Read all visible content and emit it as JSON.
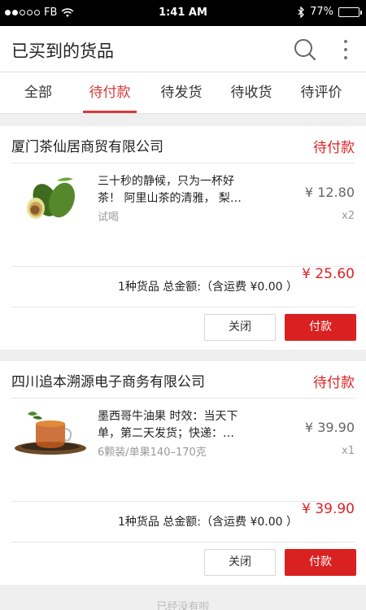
{
  "status_bar": {
    "carrier": "FB",
    "time": "1:41 AM",
    "battery": "77%",
    "battery_level": 0.77,
    "signal_bars": 2
  },
  "header": {
    "title": "已买到的货品"
  },
  "tabs": [
    {
      "label": "全部",
      "active": false
    },
    {
      "label": "待付款",
      "active": true
    },
    {
      "label": "待发货",
      "active": false
    },
    {
      "label": "待收货",
      "active": false
    },
    {
      "label": "待评价",
      "active": false
    }
  ],
  "orders": [
    {
      "store": "厦门茶仙居商贸有限公司",
      "status": "待付款",
      "product_name": "三十秒的静候，只为一杯好茶！ 阿里山茶的清雅， 梨…",
      "spec": "试喝",
      "price": "¥ 12.80",
      "qty": "x2",
      "summary": "1种货品 总金额:（含运费 ¥0.00 ）",
      "total": "¥ 25.60",
      "close_label": "关闭",
      "pay_label": "付款",
      "thumb_icon": "avocado-image"
    },
    {
      "store": "四川追本溯源电子商务有限公司",
      "status": "待付款",
      "product_name": "墨西哥牛油果 时效：当天下单，第二天发货；快递：…",
      "spec": "6颗装/单果140–170克",
      "price": "¥ 39.90",
      "qty": "x1",
      "summary": "1种货品 总金额:（含运费 ¥0.00 ）",
      "total": "¥ 39.90",
      "close_label": "关闭",
      "pay_label": "付款",
      "thumb_icon": "tea-cup-image"
    }
  ],
  "footer": {
    "end_hint": "已经没有啦"
  },
  "colors": {
    "accent": "#d33a3a",
    "pay_button": "#d92121",
    "status_red": "#dd2222"
  }
}
